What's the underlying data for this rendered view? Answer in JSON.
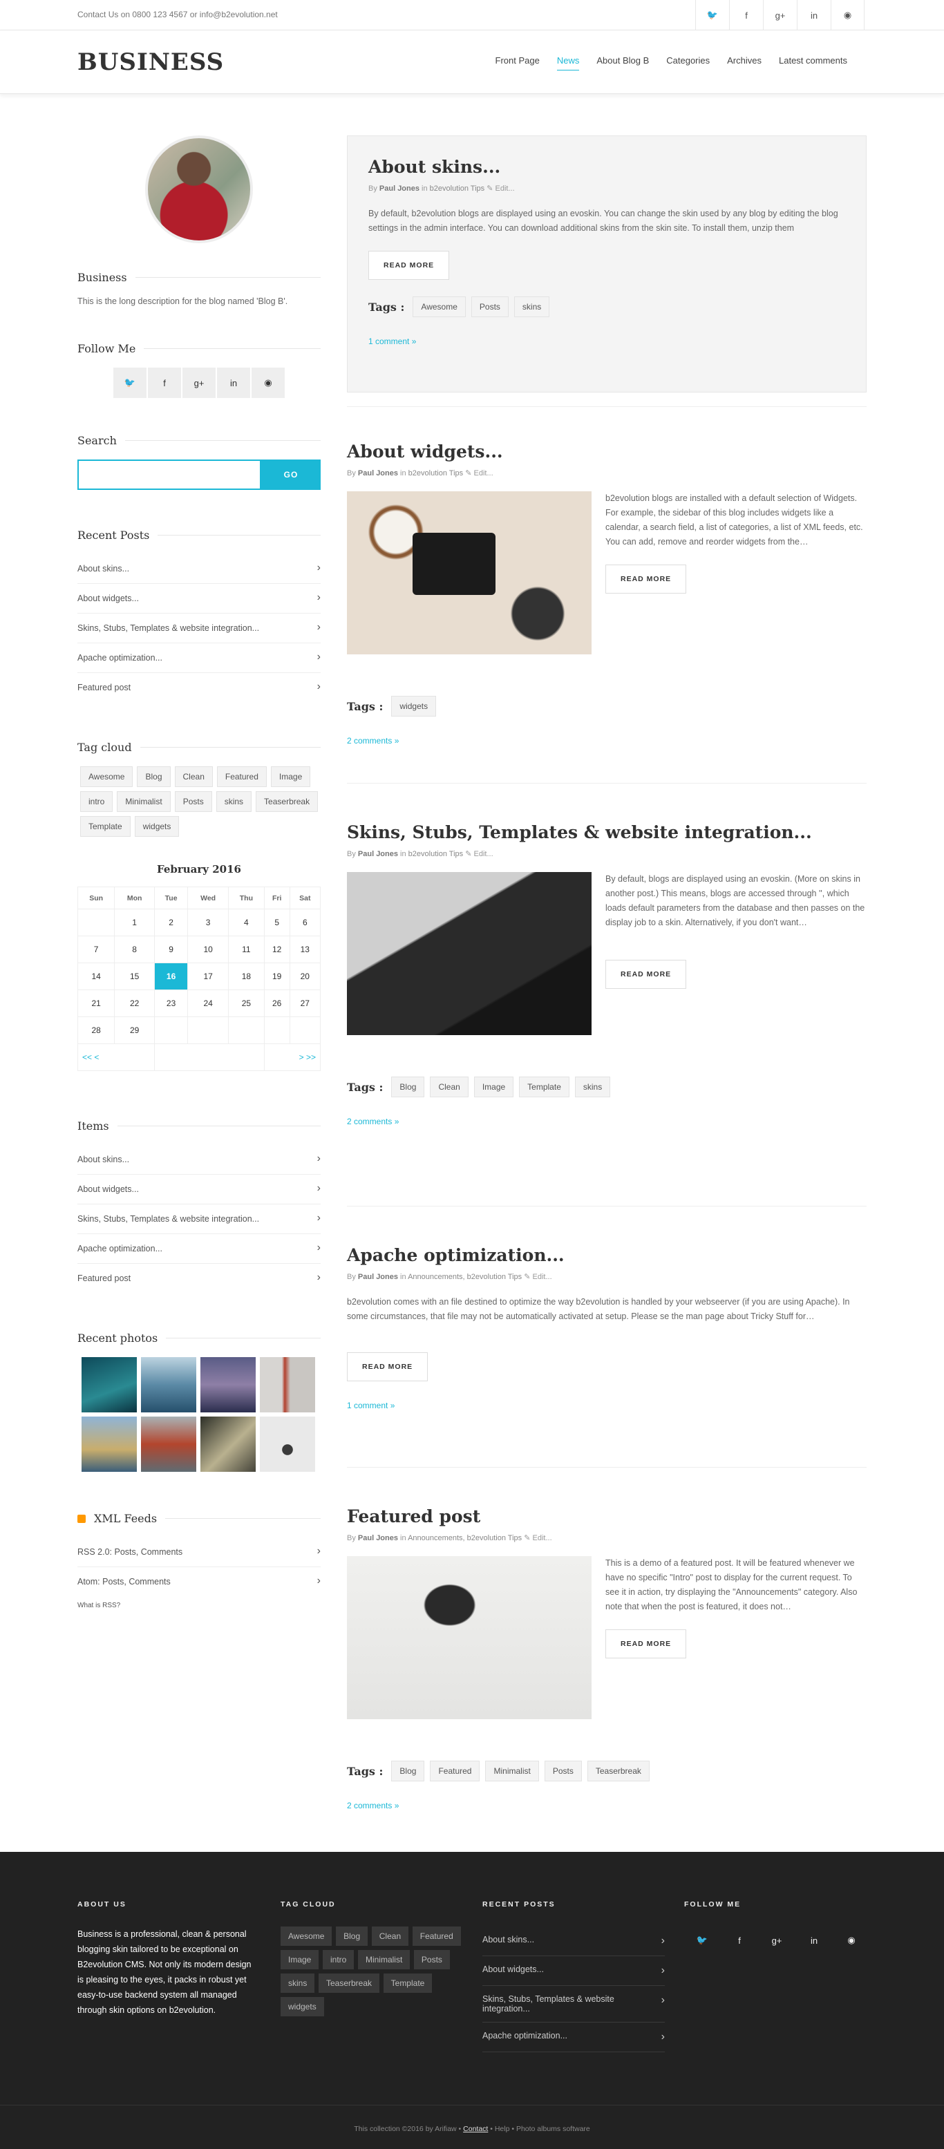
{
  "topbar": {
    "contact": "Contact Us on 0800 123 4567 or info@b2evolution.net",
    "social": [
      "twitter-icon",
      "facebook-icon",
      "googleplus-icon",
      "linkedin-icon",
      "github-icon"
    ]
  },
  "header": {
    "brand": "BUSINESS",
    "nav": [
      "Front Page",
      "News",
      "About Blog B",
      "Categories",
      "Archives",
      "Latest comments"
    ],
    "active_nav": "News"
  },
  "sidebar": {
    "blog_title": "Business",
    "blog_desc": "This is the long description for the blog named 'Blog B'.",
    "follow_title": "Follow Me",
    "search_title": "Search",
    "search_button": "GO",
    "recent_title": "Recent Posts",
    "recent": [
      "About skins...",
      "About widgets...",
      "Skins, Stubs, Templates & website integration...",
      "Apache optimization...",
      "Featured post"
    ],
    "tagcloud_title": "Tag cloud",
    "tagcloud": [
      "Awesome",
      "Blog",
      "Clean",
      "Featured",
      "Image",
      "intro",
      "Minimalist",
      "Posts",
      "skins",
      "Teaserbreak",
      "Template",
      "widgets"
    ],
    "calendar": {
      "title": "February 2016",
      "days": [
        "Sun",
        "Mon",
        "Tue",
        "Wed",
        "Thu",
        "Fri",
        "Sat"
      ],
      "weeks": [
        [
          "",
          "1",
          "2",
          "3",
          "4",
          "5",
          "6"
        ],
        [
          "7",
          "8",
          "9",
          "10",
          "11",
          "12",
          "13"
        ],
        [
          "14",
          "15",
          "16",
          "17",
          "18",
          "19",
          "20"
        ],
        [
          "21",
          "22",
          "23",
          "24",
          "25",
          "26",
          "27"
        ],
        [
          "28",
          "29",
          "",
          "",
          "",
          "",
          ""
        ]
      ],
      "today": "16",
      "prev_links": "<<  <",
      "next_links": ">  >>"
    },
    "items_title": "Items",
    "items": [
      "About skins...",
      "About widgets...",
      "Skins, Stubs, Templates & website integration...",
      "Apache optimization...",
      "Featured post"
    ],
    "photos_title": "Recent photos",
    "xml_title": "XML Feeds",
    "xml": [
      "RSS 2.0: Posts, Comments",
      "Atom: Posts, Comments"
    ],
    "what_rss": "What is RSS?"
  },
  "posts": [
    {
      "title": "About skins...",
      "by": "By",
      "author": "Paul Jones",
      "in": "in",
      "cats": "b2evolution Tips",
      "edit": "Edit...",
      "excerpt": "By default, b2evolution blogs are displayed using an evoskin. You can change the skin used by any blog by editing the blog settings in the admin interface. You can download additional skins from the skin site. To install them, unzip them",
      "read_more": "READ MORE",
      "tags_label": "Tags :",
      "tags": [
        "Awesome",
        "Posts",
        "skins"
      ],
      "comments": "1 comment »"
    },
    {
      "title": "About widgets...",
      "by": "By",
      "author": "Paul Jones",
      "in": "in",
      "cats": "b2evolution Tips",
      "edit": "Edit...",
      "excerpt": "b2evolution blogs are installed with a default selection of Widgets. For example, the sidebar of this blog includes widgets like a calendar, a search field, a list of categories, a list of XML feeds, etc. You can add, remove and reorder widgets from the…",
      "read_more": "READ MORE",
      "tags_label": "Tags :",
      "tags": [
        "widgets"
      ],
      "comments": "2 comments »"
    },
    {
      "title": "Skins, Stubs, Templates & website integration...",
      "by": "By",
      "author": "Paul Jones",
      "in": "in",
      "cats": "b2evolution Tips",
      "edit": "Edit...",
      "excerpt": "By default, blogs are displayed using an evoskin. (More on skins in another post.) This means, blogs are accessed through '', which loads default parameters from the database and then passes on the display job to a skin. Alternatively, if you don't want…",
      "read_more": "READ MORE",
      "tags_label": "Tags :",
      "tags": [
        "Blog",
        "Clean",
        "Image",
        "Template",
        "skins"
      ],
      "comments": "2 comments »"
    },
    {
      "title": "Apache optimization...",
      "by": "By",
      "author": "Paul Jones",
      "in": "in",
      "cats": "Announcements, b2evolution Tips",
      "edit": "Edit...",
      "excerpt": "b2evolution comes with an file destined to optimize the way b2evolution is handled by your webseerver (if you are using Apache). In some circumstances, that file may not be automatically activated at setup. Please se the man page about Tricky Stuff for…",
      "read_more": "READ MORE",
      "comments": "1 comment »"
    },
    {
      "title": "Featured post",
      "by": "By",
      "author": "Paul Jones",
      "in": "in",
      "cats": "Announcements, b2evolution Tips",
      "edit": "Edit...",
      "excerpt": "This is a demo of a featured post. It will be featured whenever we have no specific \"Intro\" post to display for the current request. To see it in action, try displaying the \"Announcements\" category. Also note that when the post is featured, it does not…",
      "read_more": "READ MORE",
      "tags_label": "Tags :",
      "tags": [
        "Blog",
        "Featured",
        "Minimalist",
        "Posts",
        "Teaserbreak"
      ],
      "comments": "2 comments »"
    }
  ],
  "footer": {
    "about_title": "ABOUT US",
    "about": "Business is a professional, clean & personal blogging skin tailored to be exceptional on B2evolution CMS. Not only its modern design is pleasing to the eyes, it packs in robust yet easy-to-use backend system all managed through skin options on b2evolution.",
    "tags_title": "TAG CLOUD",
    "tags": [
      "Awesome",
      "Blog",
      "Clean",
      "Featured",
      "Image",
      "intro",
      "Minimalist",
      "Posts",
      "skins",
      "Teaserbreak",
      "Template",
      "widgets"
    ],
    "recent_title": "RECENT POSTS",
    "recent": [
      "About skins...",
      "About widgets...",
      "Skins, Stubs, Templates & website integration...",
      "Apache optimization..."
    ],
    "follow_title": "FOLLOW ME",
    "copyright": "This collection ©2016 by Arifiaw •",
    "contact": "Contact",
    "help": "• Help •",
    "software": "Photo albums software"
  },
  "colors": {
    "accent": "#1bb8d6",
    "footer_bg": "#222222"
  }
}
